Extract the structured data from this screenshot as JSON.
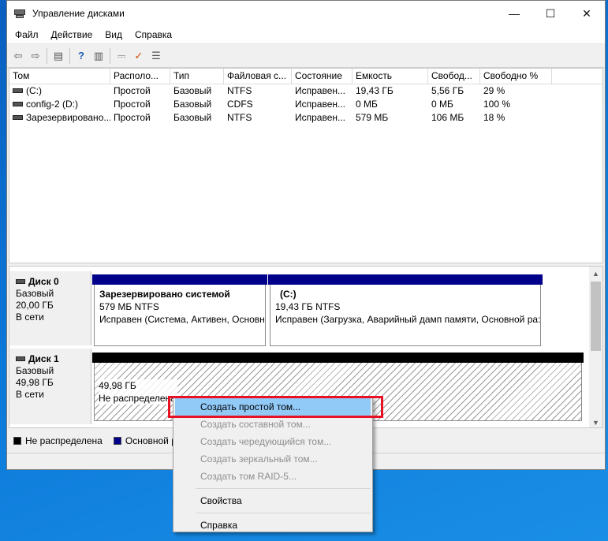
{
  "window": {
    "title": "Управление дисками",
    "controls": {
      "minimize": "—",
      "maximize": "☐",
      "close": "✕"
    }
  },
  "menu": [
    "Файл",
    "Действие",
    "Вид",
    "Справка"
  ],
  "toolbar": {
    "icons": [
      "back-arrow-icon",
      "forward-arrow-icon",
      "console-tree-icon",
      "help-icon",
      "properties-icon",
      "connect-icon",
      "checkmark-icon",
      "settings-list-icon"
    ],
    "glyphs": [
      "⇦",
      "⇨",
      "▤",
      "?",
      "▥",
      "⎓",
      "✓",
      "☰"
    ]
  },
  "volume_list": {
    "columns": [
      "Том",
      "Располо...",
      "Тип",
      "Файловая с...",
      "Состояние",
      "Емкость",
      "Свобод...",
      "Свободно %"
    ],
    "rows": [
      [
        "(C:)",
        "Простой",
        "Базовый",
        "NTFS",
        "Исправен...",
        "19,43 ГБ",
        "5,56 ГБ",
        "29 %"
      ],
      [
        "config-2 (D:)",
        "Простой",
        "Базовый",
        "CDFS",
        "Исправен...",
        "0 МБ",
        "0 МБ",
        "100 %"
      ],
      [
        "Зарезервировано...",
        "Простой",
        "Базовый",
        "NTFS",
        "Исправен...",
        "579 МБ",
        "106 МБ",
        "18 %"
      ]
    ]
  },
  "disks": [
    {
      "name": "Диск 0",
      "type": "Базовый",
      "size": "20,00 ГБ",
      "status": "В сети",
      "partitions": [
        {
          "title": "Зарезервировано системой",
          "size": "579 МБ NTFS",
          "status": "Исправен (Система, Активен, Основн"
        },
        {
          "title": "(C:)",
          "size": "19,43 ГБ NTFS",
          "status": "Исправен (Загрузка, Аварийный дамп памяти, Основной ра:"
        }
      ]
    },
    {
      "name": "Диск 1",
      "type": "Базовый",
      "size": "49,98 ГБ",
      "status": "В сети",
      "unallocated": {
        "size": "49,98 ГБ",
        "label": "Не распределена"
      }
    }
  ],
  "legend": [
    {
      "label": "Не распределена",
      "color": "#000000"
    },
    {
      "label": "Основной ра",
      "color": "#00008b"
    }
  ],
  "context_menu": {
    "group1": [
      {
        "label": "Создать простой том...",
        "enabled": true,
        "highlighted": true
      },
      {
        "label": "Создать составной том...",
        "enabled": false
      },
      {
        "label": "Создать чередующийся том...",
        "enabled": false
      },
      {
        "label": "Создать зеркальный том...",
        "enabled": false
      },
      {
        "label": "Создать том RAID-5...",
        "enabled": false
      }
    ],
    "group2": [
      {
        "label": "Свойства",
        "enabled": true
      }
    ],
    "group3": [
      {
        "label": "Справка",
        "enabled": true
      }
    ]
  }
}
